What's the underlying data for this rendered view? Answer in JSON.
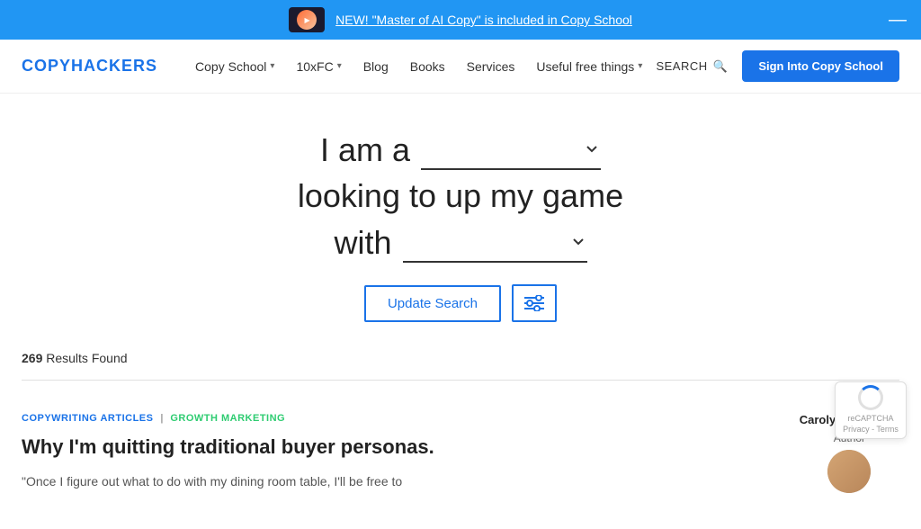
{
  "banner": {
    "text": "NEW! \"Master of AI Copy\" is included in Copy School",
    "close_label": "—"
  },
  "navbar": {
    "logo": "COPYHACKERS",
    "items": [
      {
        "label": "Copy School",
        "has_dropdown": true
      },
      {
        "label": "10xFC",
        "has_dropdown": true
      },
      {
        "label": "Blog",
        "has_dropdown": false
      },
      {
        "label": "Books",
        "has_dropdown": false
      },
      {
        "label": "Services",
        "has_dropdown": false
      },
      {
        "label": "Useful free things",
        "has_dropdown": true
      }
    ],
    "search_label": "SEARCH",
    "sign_in_label": "Sign Into Copy School"
  },
  "search_form": {
    "prefix1": "I am a",
    "dropdown1_placeholder": "",
    "line2": "looking to up my game",
    "prefix3": "with",
    "dropdown2_placeholder": "",
    "update_button": "Update Search",
    "filter_button_label": "Filters"
  },
  "results": {
    "count": "269",
    "count_label": "Results Found"
  },
  "article": {
    "tags": [
      {
        "label": "COPYWRITING ARTICLES",
        "color": "blue"
      },
      {
        "label": "GROWTH MARKETING",
        "color": "green"
      }
    ],
    "title": "Why I'm quitting traditional buyer personas.",
    "excerpt": "\"Once I figure out what to do with my dining room table, I'll be free to",
    "author": {
      "name": "Carolyn Beaudoin",
      "role": "Author"
    }
  },
  "gdpr": {
    "text": "reCAPTCHA\nPrivacy - Terms"
  }
}
